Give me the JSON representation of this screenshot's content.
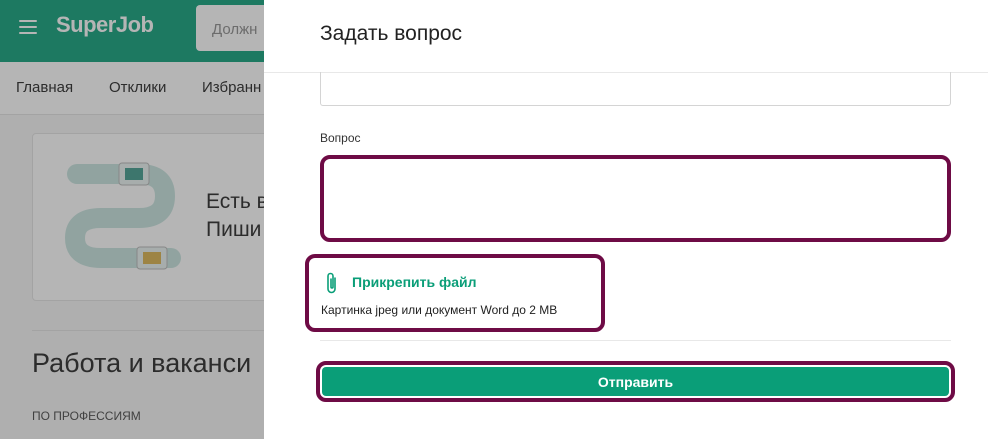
{
  "app": {
    "logo": "SuperJob"
  },
  "search": {
    "placeholder": "Должн"
  },
  "nav": {
    "items": [
      "Главная",
      "Отклики",
      "Избранн"
    ]
  },
  "promo": {
    "line1": "Есть в",
    "line2": "Пиши"
  },
  "background": {
    "heading": "Работа и ваканси",
    "subheading": "ПО ПРОФЕССИЯМ"
  },
  "modal": {
    "title": "Задать вопрос",
    "question_label": "Вопрос",
    "question_value": "",
    "attach_label": "Прикрепить файл",
    "attach_hint": "Картинка jpeg или документ Word до 2 MB",
    "submit_label": "Отправить"
  },
  "colors": {
    "brand": "#0a9e78",
    "highlight": "#6e0b45",
    "overlay": "rgba(60,60,60,0.38)"
  },
  "icons": {
    "menu": "hamburger-icon",
    "attach": "paperclip-icon"
  }
}
